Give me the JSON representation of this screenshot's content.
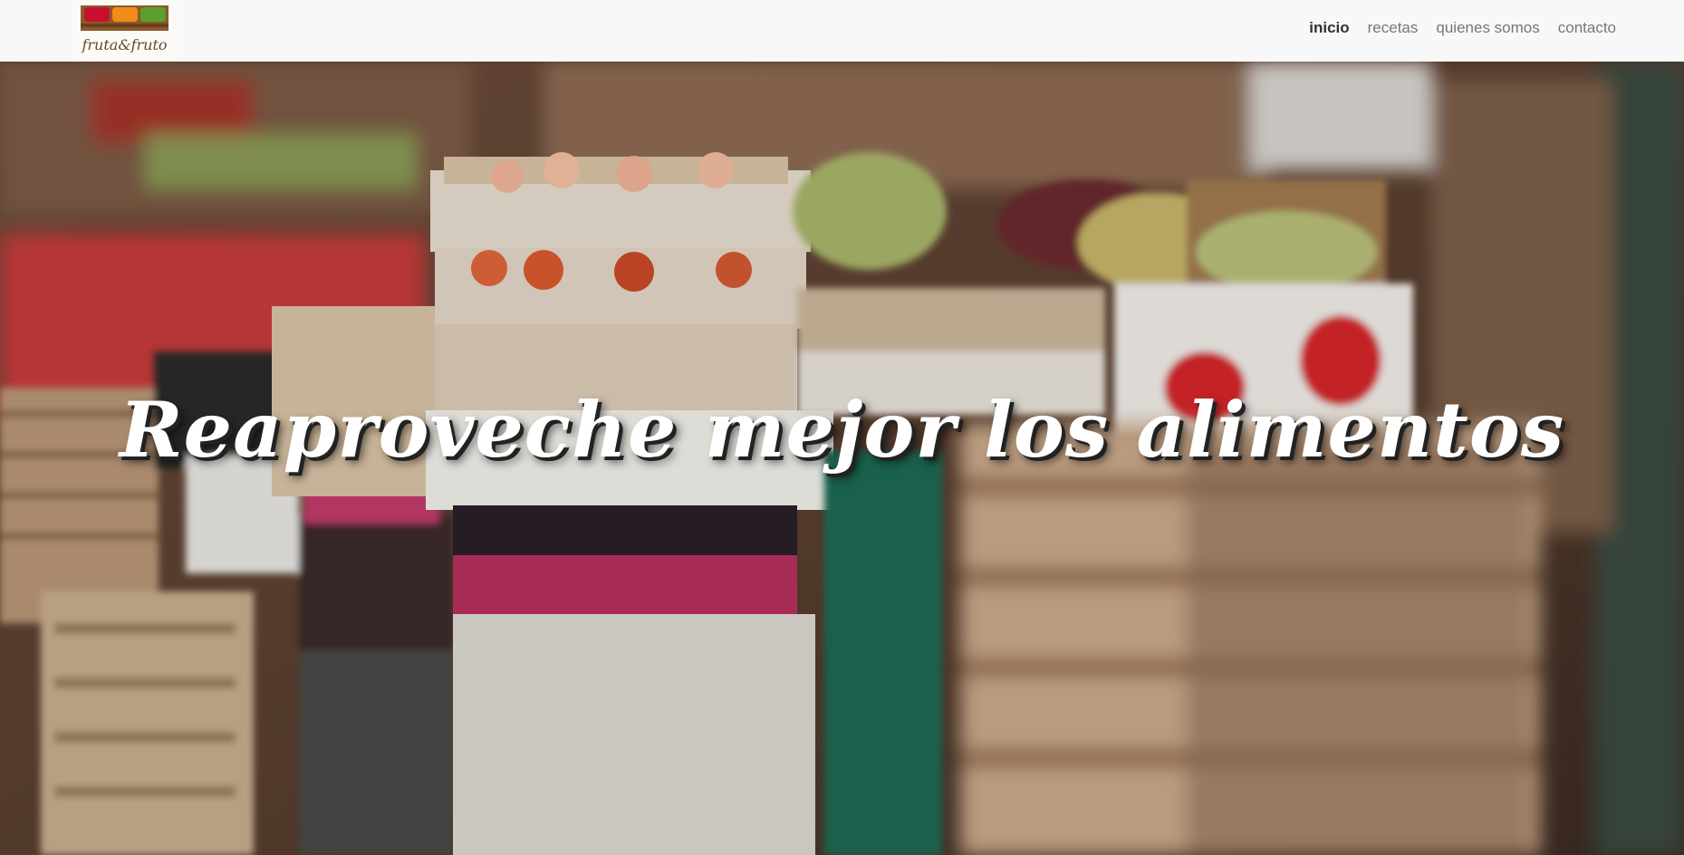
{
  "brand": {
    "logo_text": "fruta&fruto"
  },
  "nav": {
    "items": [
      {
        "label": "inicio",
        "active": true
      },
      {
        "label": "recetas",
        "active": false
      },
      {
        "label": "quienes somos",
        "active": false
      },
      {
        "label": "contacto",
        "active": false
      }
    ]
  },
  "hero": {
    "title": "Reaproveche mejor los alimentos",
    "background": "market-crates-photo"
  },
  "colors": {
    "navbar_bg": "#f8f8f8",
    "nav_active": "#333333",
    "nav_inactive": "#777777",
    "hero_text": "#ffffff"
  }
}
